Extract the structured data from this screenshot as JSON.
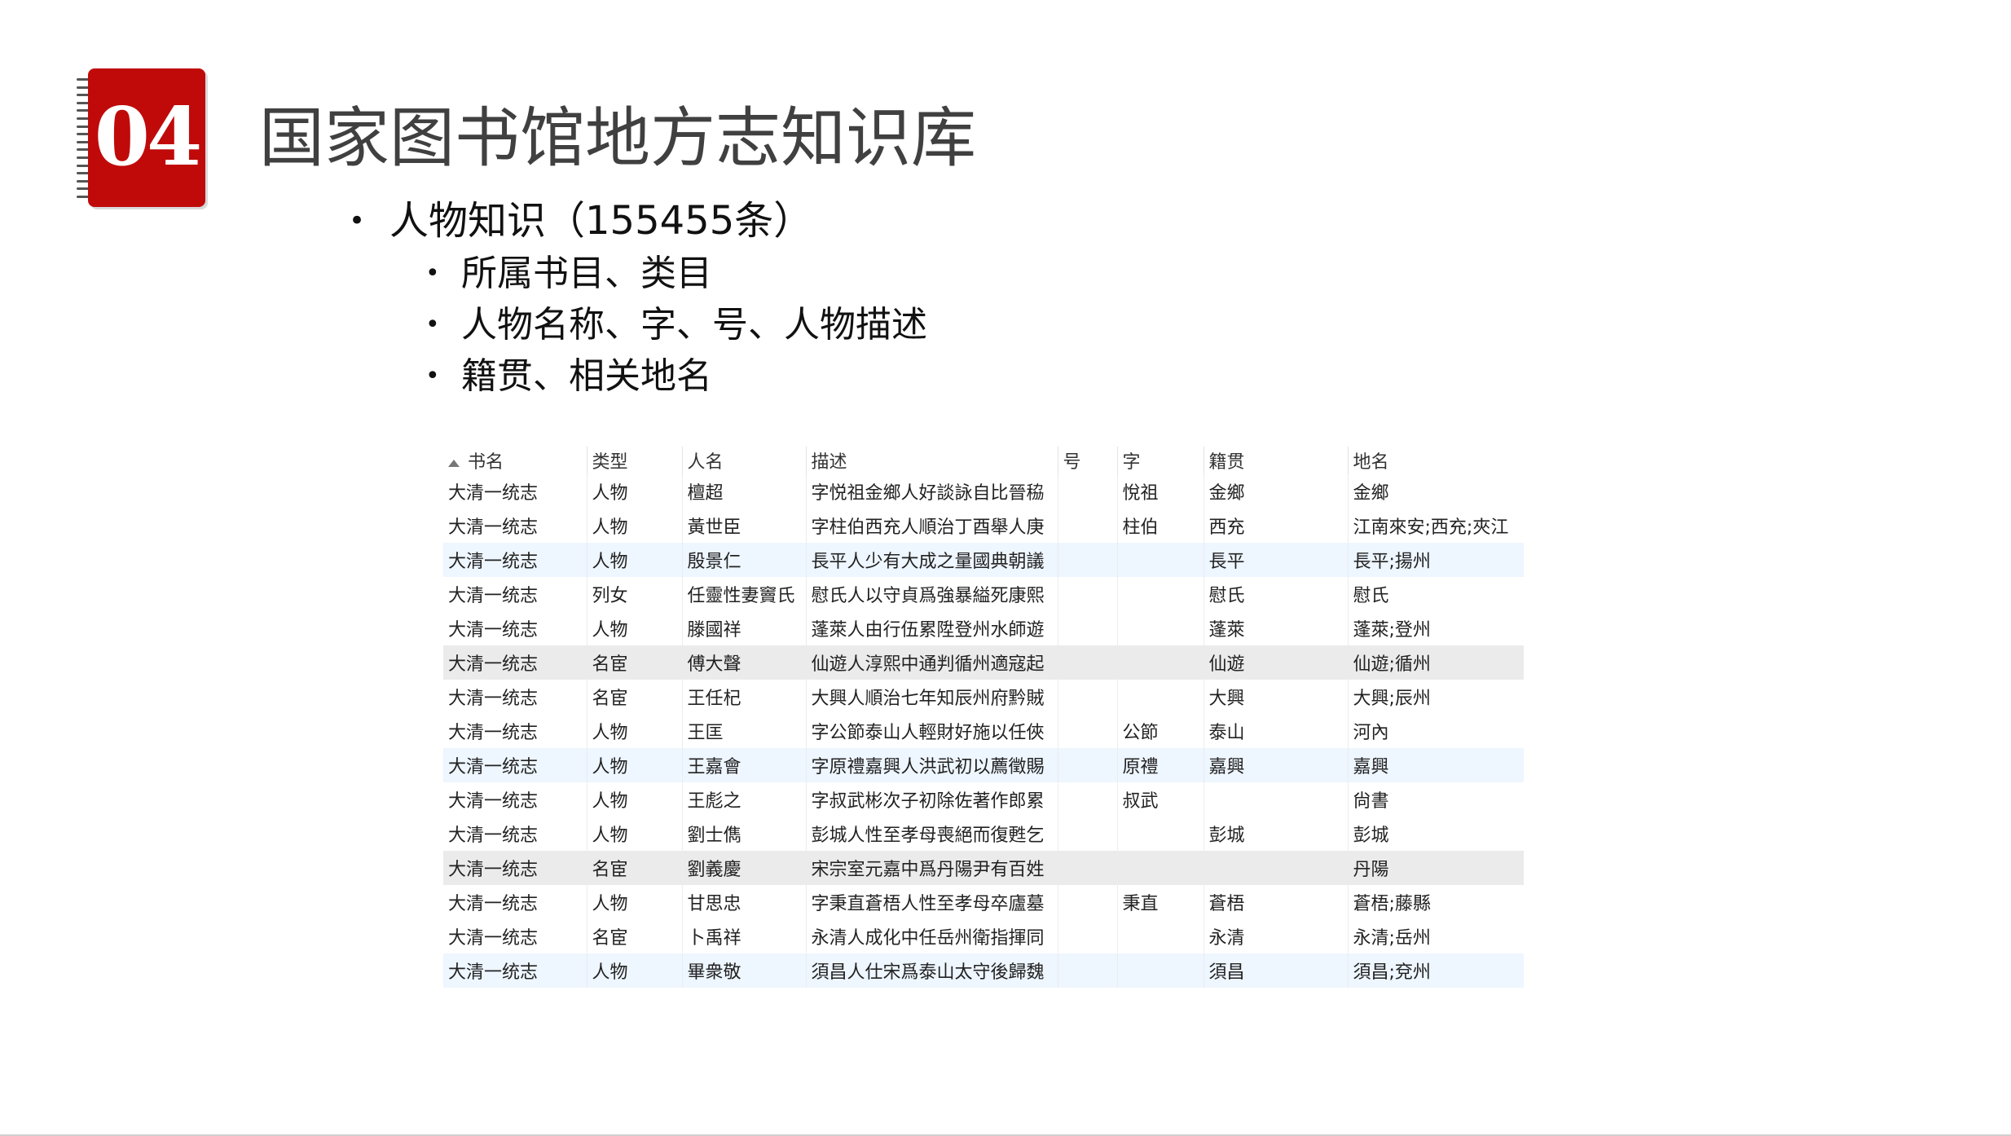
{
  "badge": {
    "number": "04"
  },
  "title": "国家图书馆地方志知识库",
  "bullets": {
    "main": "人物知识（155455条）",
    "subs": [
      "所属书目、类目",
      "人物名称、字、号、人物描述",
      "籍贯、相关地名"
    ]
  },
  "table": {
    "columns": [
      "书名",
      "类型",
      "人名",
      "描述",
      "号",
      "字",
      "籍贯",
      "地名"
    ],
    "sort_column": "书名",
    "rows": [
      [
        "大清一统志",
        "人物",
        "檀超",
        "字悦祖金鄉人好談詠自比晉䅄",
        "",
        "悅祖",
        "金鄉",
        "金鄉"
      ],
      [
        "大清一统志",
        "人物",
        "黃世臣",
        "字柱伯西充人順治丁酉舉人庚",
        "",
        "柱伯",
        "西充",
        "江南來安;西充;夾江"
      ],
      [
        "大清一统志",
        "人物",
        "殷景仁",
        "長平人少有大成之量國典朝議",
        "",
        "",
        "長平",
        "長平;揚州"
      ],
      [
        "大清一统志",
        "列女",
        "任靈性妻竇氏",
        "慰氏人以守貞爲強暴縊死康熙",
        "",
        "",
        "慰氏",
        "慰氏"
      ],
      [
        "大清一统志",
        "人物",
        "滕國祥",
        "蓬萊人由行伍累陞登州水師遊",
        "",
        "",
        "蓬萊",
        "蓬萊;登州"
      ],
      [
        "大清一统志",
        "名宦",
        "傅大聲",
        "仙遊人淳熙中通判循州適寇起",
        "",
        "",
        "仙遊",
        "仙遊;循州"
      ],
      [
        "大清一统志",
        "名宦",
        "王任杞",
        "大興人順治七年知辰州府黔賊",
        "",
        "",
        "大興",
        "大興;辰州"
      ],
      [
        "大清一统志",
        "人物",
        "王匡",
        "字公節泰山人輕財好施以任俠",
        "",
        "公節",
        "泰山",
        "河內"
      ],
      [
        "大清一统志",
        "人物",
        "王嘉會",
        "字原禮嘉興人洪武初以薦徵賜",
        "",
        "原禮",
        "嘉興",
        "嘉興"
      ],
      [
        "大清一统志",
        "人物",
        "王彪之",
        "字叔武彬次子初除佐著作郎累",
        "",
        "叔武",
        "",
        "尙書"
      ],
      [
        "大清一统志",
        "人物",
        "劉士儁",
        "彭城人性至孝母喪絕而復甦乞",
        "",
        "",
        "彭城",
        "彭城"
      ],
      [
        "大清一统志",
        "名宦",
        "劉義慶",
        "宋宗室元嘉中爲丹陽尹有百姓",
        "",
        "",
        "",
        "丹陽"
      ],
      [
        "大清一统志",
        "人物",
        "甘思忠",
        "字秉直蒼梧人性至孝母卒廬墓",
        "",
        "秉直",
        "蒼梧",
        "蒼梧;藤縣"
      ],
      [
        "大清一统志",
        "名宦",
        "卜禹祥",
        "永清人成化中任岳州衛指揮同",
        "",
        "",
        "永清",
        "永清;岳州"
      ],
      [
        "大清一统志",
        "人物",
        "畢衆敬",
        "須昌人仕宋爲泰山太守後歸魏",
        "",
        "",
        "須昌",
        "須昌;兗州"
      ]
    ],
    "row_styles": [
      "",
      "",
      "alt",
      "",
      "",
      "gray",
      "",
      "",
      "alt",
      "",
      "",
      "gray",
      "",
      "",
      "alt"
    ]
  }
}
